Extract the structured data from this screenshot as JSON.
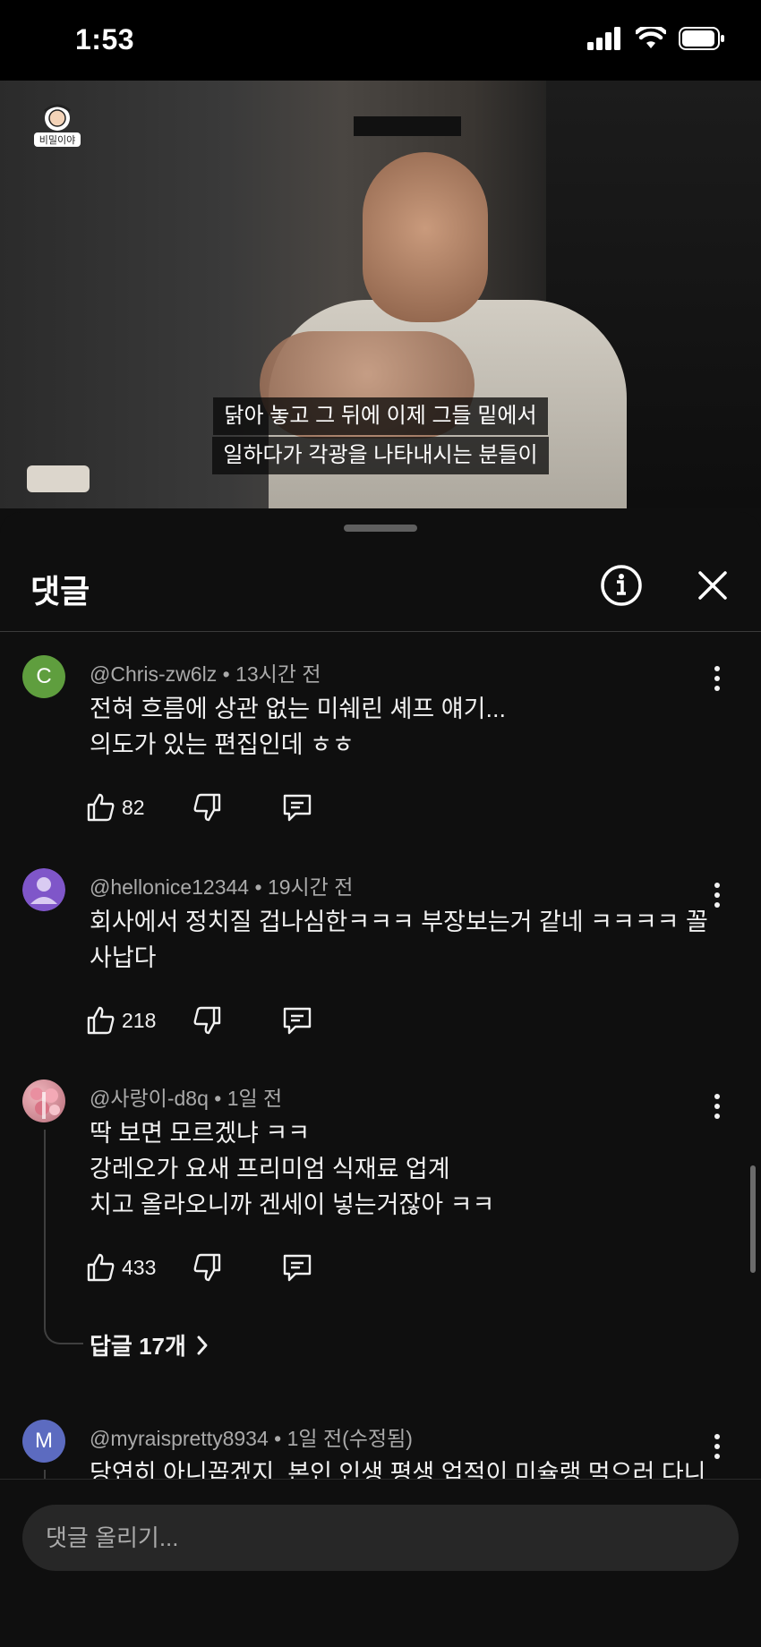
{
  "status_bar": {
    "time": "1:53"
  },
  "video": {
    "channel_logo_text": "비밀이야",
    "subtitle_line1": "닭아 놓고 그 뒤에 이제 그들 밑에서",
    "subtitle_line2": "일하다가 각광을 나타내시는 분들이",
    "progress": 0.45
  },
  "comments_panel": {
    "title": "댓글",
    "comments": [
      {
        "avatar_letter": "C",
        "avatar_color": "#5f9e3e",
        "author": "@Chris-zw6lz",
        "time": "13시간 전",
        "text": "전혀 흐름에 상관 없는 미쉐린 셰프 얘기...\n의도가 있는 편집인데 ㅎㅎ",
        "likes": "82"
      },
      {
        "avatar_letter": "",
        "avatar_color": "#7f56c9",
        "author": "@hellonice12344",
        "time": "19시간 전",
        "text": "회사에서 정치질 겁나심한ㅋㅋㅋ 부장보는거 같네 ㅋㅋㅋㅋ 꼴\n사납다",
        "likes": "218"
      },
      {
        "avatar_letter": "",
        "avatar_color": "#c98a95",
        "author": "@사랑이-d8q",
        "time": "1일 전",
        "text": "딱 보면 모르겠냐 ㅋㅋ\n강레오가 요새 프리미엄 식재료 업계\n치고 올라오니까 겐세이 넣는거잖아 ㅋㅋ",
        "likes": "433",
        "replies_label": "답글 17개"
      },
      {
        "avatar_letter": "M",
        "avatar_color": "#5c6bc0",
        "author": "@myraispretty8934",
        "time": "1일 전(수정됨)",
        "text": "당연히 아니꼽겠지. 본인 인생 평생 업적이 미슐랭 먹으러 다니"
      }
    ],
    "input_placeholder": "댓글 올리기..."
  }
}
